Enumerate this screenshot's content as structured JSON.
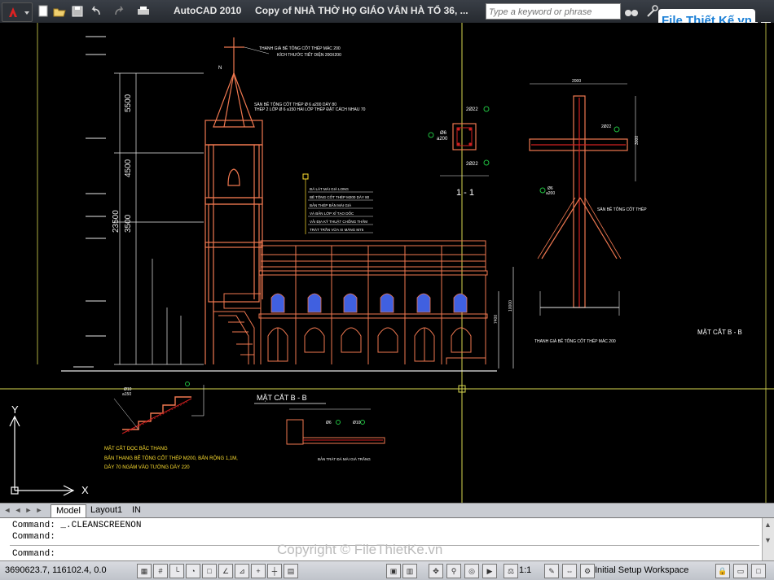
{
  "titlebar": {
    "app_title": "AutoCAD 2010",
    "document_title": "Copy of NHÀ THỜ HỌ GIÁO VÂN HÀ TỔ 36, ...",
    "search_placeholder": "Type a keyword or phrase",
    "brand": "File Thiết Kế.vn"
  },
  "drawing": {
    "annotations": {
      "cross_top_note_1": "THANH GIÀ BÊ TÔNG CỐT THÉP MÁC 200",
      "cross_top_note_2": "KÍCH THƯỚC TIẾT DIỆN 200X200",
      "spire_note_1": "SÀN BÊ TÔNG CỐT THÉP Ø 6 a200 DÀY 80",
      "spire_note_2": "THÉP 2 LỚP Ø 6 a150 HAI LỚP THÉP ĐẶT CÁCH NHAU 70",
      "section_label": "1 - 1",
      "cross_dim_width": "2000",
      "cross_dim_height": "3000",
      "cross_note": "SÀN BÊ TÔNG CỐT THÉP",
      "cross_bottom_note": "THANH GIÀ BÊ TÔNG CỐT THÉP MÁC 200",
      "matcat_right": "MẶT CẮT B - B",
      "matcat_center": "MẶT CẮT B - B",
      "stair_title": "MẶT CẮT DỌC BẬC THANG",
      "stair_note_1": "BẢN THANG BÊ TÔNG CỐT THÉP M200, BẢN RỘNG 1,1M,",
      "stair_note_2": "DÀY 70 NGÀM VÀO TƯỜNG DÀY 220",
      "bar_22": "2Ø22",
      "bar_6": "Ø6",
      "bar_a200": "a200",
      "stair_bar": "Ø10",
      "stair_bar_spacing": "a150",
      "dim_5500": "5500",
      "dim_4500": "4500",
      "dim_3500": "3500",
      "dim_23500": "23500",
      "dim_10000": "10000",
      "dim_7400": "7400",
      "layer_notes": [
        "ĐÁ LÁT MÁI GIÀ LONG",
        "BÊ TÔNG CỐT THÉP M200 DÀY 80",
        "BẢN THÉP BẢN MÀI GIÀ",
        "VÀ BẢN LỚP XỈ TẠO DỐC",
        "VẢI ĐỊA KỸ THUẬT CHỐNG THẤM",
        "TRÁT TRẦN VỮA XI MĂNG M75"
      ],
      "north_label": "N",
      "bottom_detail_note": "BẢN TRÁT ĐÁ MÀI GIÀ TRẮNG"
    },
    "ucs": {
      "x_label": "X",
      "y_label": "Y"
    },
    "colors": {
      "background": "#000000",
      "structure": "#f07850",
      "wall_red": "#d02020",
      "text": "#ffffff",
      "dimension": "#e8e8e8",
      "window_blue": "#4060e0",
      "annotation_yellow": "#ffe030",
      "leader_green": "#20c040",
      "crosshair": "#d8d850"
    }
  },
  "tabs": {
    "model": "Model",
    "layout1": "Layout1",
    "in": "IN"
  },
  "command": {
    "line1": "Command:  _.CLEANSCREENON",
    "line2": "Command:",
    "line3": "Command:"
  },
  "watermark": "Copyright © FileThietKe.vn",
  "statusbar": {
    "coords": "3690623.7, 116102.4, 0.0",
    "scale": "1:1",
    "workspace": "Initial Setup Workspace"
  },
  "icons": {
    "new": "new-file-icon",
    "open": "open-folder-icon",
    "save": "save-icon",
    "undo": "undo-icon",
    "redo": "redo-icon",
    "plot": "plot-icon",
    "binoculars": "binoculars-icon",
    "tools": "wrench-icon",
    "star": "star-icon",
    "help": "help-icon"
  }
}
